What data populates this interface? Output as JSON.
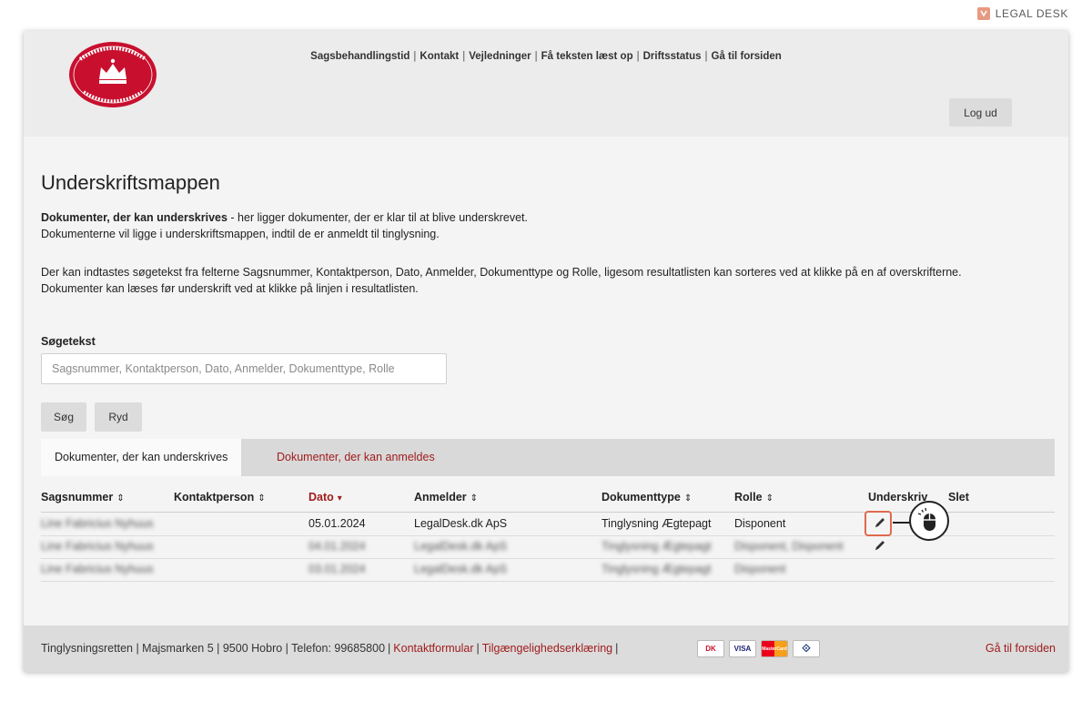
{
  "brand": {
    "name": "LEGAL DESK"
  },
  "logo": {
    "top_text": "TINGLYSNINGSRETTEN",
    "bottom_text": "DANMARKS DOMSTOLE",
    "color": "#c8102e"
  },
  "topnav": [
    "Sagsbehandlingstid",
    "Kontakt",
    "Vejledninger",
    "Få teksten læst op",
    "Driftsstatus",
    "Gå til forsiden"
  ],
  "header": {
    "logout_label": "Log ud"
  },
  "page": {
    "title": "Underskriftsmappen",
    "intro_bold": "Dokumenter, der kan underskrives",
    "intro_rest": " - her ligger dokumenter, der er klar til at blive underskrevet.",
    "intro_line2": "Dokumenterne vil ligge i underskriftsmappen, indtil de er anmeldt til tinglysning.",
    "help_line1": "Der kan indtastes søgetekst fra felterne Sagsnummer, Kontaktperson, Dato, Anmelder, Dokumenttype og Rolle, ligesom resultatlisten kan sorteres ved at klikke på en af overskrifterne.",
    "help_line2": "Dokumenter kan læses før underskrift ved at klikke på linjen i resultatlisten."
  },
  "search": {
    "label": "Søgetekst",
    "placeholder": "Sagsnummer, Kontaktperson, Dato, Anmelder, Dokumenttype, Rolle",
    "search_label": "Søg",
    "clear_label": "Ryd"
  },
  "tabs": {
    "active": "Dokumenter, der kan underskrives",
    "inactive": "Dokumenter, der kan anmeldes"
  },
  "table": {
    "columns": {
      "sagsnummer": "Sagsnummer",
      "kontaktperson": "Kontaktperson",
      "dato": "Dato",
      "anmelder": "Anmelder",
      "dokumenttype": "Dokumenttype",
      "rolle": "Rolle",
      "underskriv": "Underskriv",
      "slet": "Slet"
    },
    "sort_icon": "⇕",
    "sorted_icon": "▾",
    "rows": [
      {
        "sagsnummer": "Line Fabricius Nyhuus",
        "dato": "05.01.2024",
        "anmelder": "LegalDesk.dk ApS",
        "dokumenttype": "Tinglysning Ægtepagt",
        "rolle": "Disponent"
      },
      {
        "sagsnummer": "Line Fabricius Nyhuus",
        "dato": "04.01.2024",
        "anmelder": "LegalDesk.dk ApS",
        "dokumenttype": "Tinglysning Ægtepagt",
        "rolle": "Disponent, Disponent"
      },
      {
        "sagsnummer": "Line Fabricius Nyhuus",
        "dato": "03.01.2024",
        "anmelder": "LegalDesk.dk ApS",
        "dokumenttype": "Tinglysning Ægtepagt",
        "rolle": "Disponent"
      }
    ]
  },
  "footer": {
    "address": "Tinglysningsretten | Majsmarken 5 | 9500 Hobro | Telefon: 99685800",
    "contact_link": "Kontaktformular",
    "accessibility_link": "Tilgængelighedserklæring",
    "cards": [
      "DK",
      "VISA",
      "MasterCard",
      "⟐"
    ],
    "home_link": "Gå til forsiden"
  },
  "colors": {
    "accent_red": "#a01c1c",
    "highlight": "#e06a4e"
  }
}
